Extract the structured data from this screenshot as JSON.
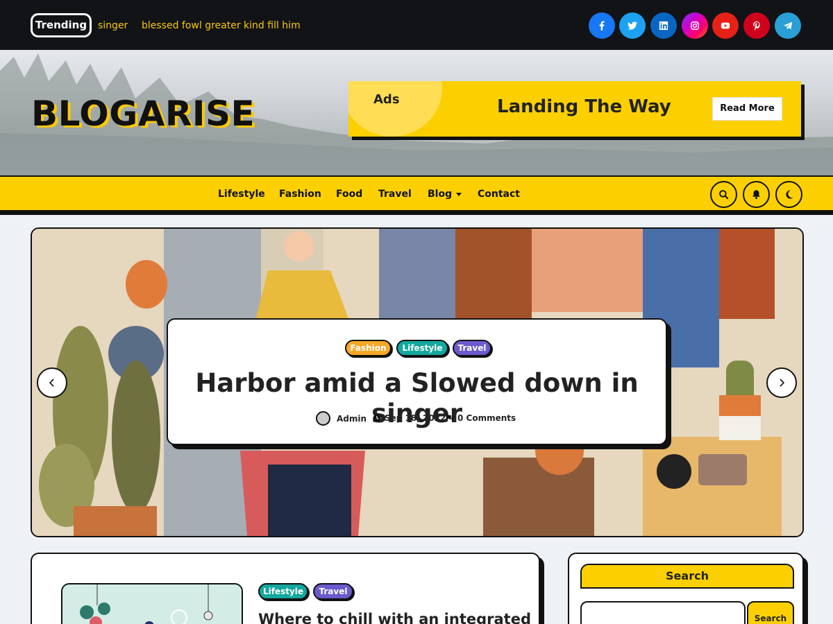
{
  "topbar": {
    "trending_label": "Trending",
    "trending_items": [
      "singer",
      "blessed fowl greater kind fill him"
    ],
    "social": [
      {
        "name": "facebook-icon",
        "color": "#1877f2"
      },
      {
        "name": "twitter-icon",
        "color": "#1da1f2"
      },
      {
        "name": "linkedin-icon",
        "color": "#0a66c2"
      },
      {
        "name": "instagram-icon",
        "color": "#d300c5"
      },
      {
        "name": "youtube-icon",
        "color": "#e62117"
      },
      {
        "name": "pinterest-icon",
        "color": "#d0021b"
      },
      {
        "name": "telegram-icon",
        "color": "#2a9fd6"
      }
    ]
  },
  "header": {
    "logo": "BLOGARISE",
    "ad": {
      "label": "Ads",
      "title": "Landing The Way",
      "button": "Read More"
    }
  },
  "nav": {
    "items": [
      "Lifestyle",
      "Fashion",
      "Food",
      "Travel",
      "Blog",
      "Contact"
    ],
    "icons": [
      "search-icon",
      "bell-icon",
      "moon-icon"
    ]
  },
  "slider": {
    "tags": [
      "Fashion",
      "Lifestyle",
      "Travel"
    ],
    "title": "Harbor amid a Slowed down in singer",
    "author": "Admin",
    "date": "Sep 18, 2022",
    "comments": "0 Comments"
  },
  "post": {
    "tags": [
      "Lifestyle",
      "Travel"
    ],
    "title": "Where to chill with an integrated"
  },
  "sidebar": {
    "search_title": "Search",
    "search_button": "Search",
    "search_value": ""
  },
  "colors": {
    "accent": "#fcd000",
    "dark": "#121316",
    "fashion": "#f6a828",
    "lifestyle": "#14a89e",
    "travel": "#6a5acd"
  }
}
